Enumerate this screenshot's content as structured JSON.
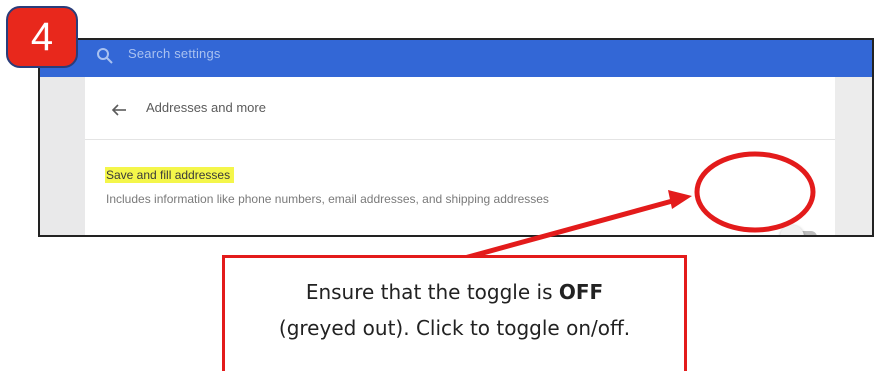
{
  "step": {
    "number": "4"
  },
  "search": {
    "placeholder": "Search settings",
    "icon": "search-icon"
  },
  "section": {
    "title": "Addresses and more",
    "back_icon": "arrow-left-icon"
  },
  "setting": {
    "label": "Save and fill addresses",
    "description": "Includes information like phone numbers, email addresses, and shipping addresses",
    "toggle_state": "off"
  },
  "callout": {
    "line1_prefix": "Ensure that the toggle is ",
    "line1_bold": "OFF",
    "line2": "(greyed out). Click to toggle on/off."
  },
  "colors": {
    "topbar": "#3367d6",
    "highlight": "#f4f64a",
    "annotation_red": "#e31b1b",
    "badge_red": "#e8281c"
  }
}
